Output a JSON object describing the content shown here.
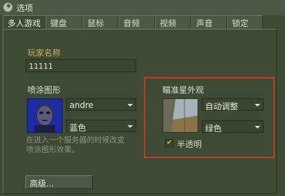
{
  "window": {
    "title": "选项"
  },
  "tabs": [
    "多人游戏",
    "键盘",
    "鼠标",
    "音频",
    "视频",
    "声音",
    "锁定"
  ],
  "player": {
    "label": "玩家名称",
    "value": "11111"
  },
  "spray": {
    "label": "喷涂图形",
    "logo_value": "andre",
    "color_value": "蓝色",
    "hint_line1": "在进入一个服务器的时候改变",
    "hint_line2": "喷涂图形效果。"
  },
  "crosshair": {
    "label": "瞄准星外观",
    "size_value": "自动调整",
    "color_value": "绿色",
    "translucent_label": "半透明",
    "translucent_checked": true,
    "highlight_color": "#d8332b"
  },
  "advanced_button": "高级..."
}
